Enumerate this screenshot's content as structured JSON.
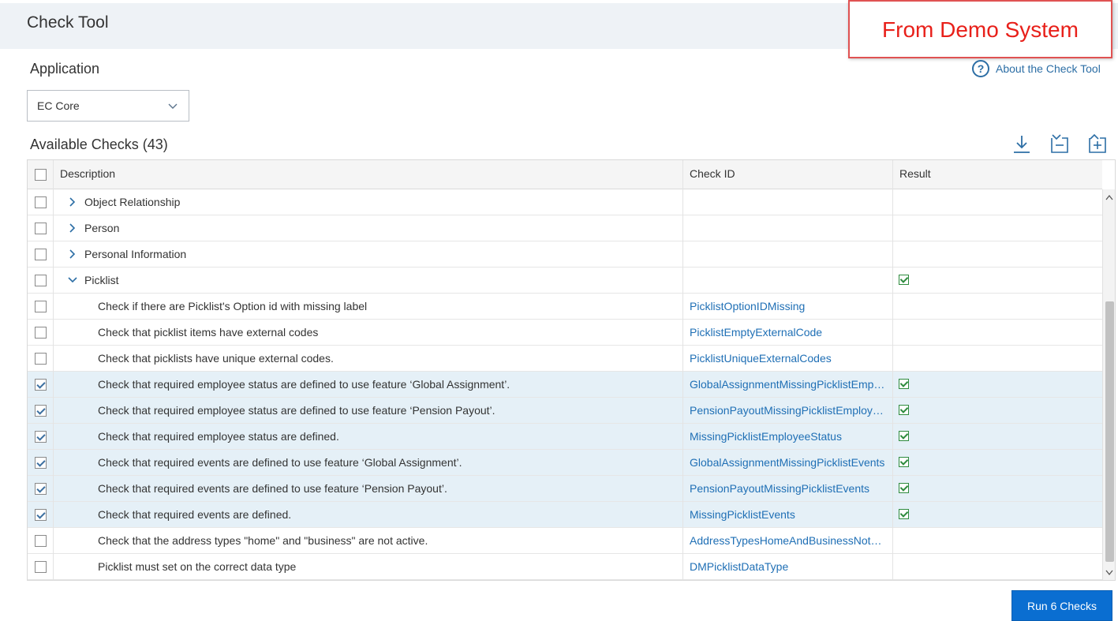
{
  "header": {
    "title": "Check Tool"
  },
  "annotation": {
    "text": "From Demo System"
  },
  "application": {
    "label": "Application",
    "selected": "EC Core",
    "about_icon": "?",
    "about_link": "About the Check Tool"
  },
  "checks": {
    "heading": "Available Checks (43)",
    "toolbar_icons": [
      "download-icon",
      "collapse-all-icon",
      "expand-all-icon"
    ],
    "columns": {
      "description": "Description",
      "check_id": "Check ID",
      "result": "Result"
    },
    "rows": [
      {
        "description": "Object Relationship",
        "check_id": "",
        "level": 0,
        "expander": "collapsed",
        "checked": false,
        "result": false
      },
      {
        "description": "Person",
        "check_id": "",
        "level": 0,
        "expander": "collapsed",
        "checked": false,
        "result": false
      },
      {
        "description": "Personal Information",
        "check_id": "",
        "level": 0,
        "expander": "collapsed",
        "checked": false,
        "result": false
      },
      {
        "description": "Picklist",
        "check_id": "",
        "level": 0,
        "expander": "expanded",
        "checked": false,
        "result": true
      },
      {
        "description": "Check if there are Picklist's Option id with missing label",
        "check_id": "PicklistOptionIDMissing",
        "level": 1,
        "expander": "none",
        "checked": false,
        "result": false
      },
      {
        "description": "Check that picklist items have external codes",
        "check_id": "PicklistEmptyExternalCode",
        "level": 1,
        "expander": "none",
        "checked": false,
        "result": false
      },
      {
        "description": "Check that picklists have unique external codes.",
        "check_id": "PicklistUniqueExternalCodes",
        "level": 1,
        "expander": "none",
        "checked": false,
        "result": false
      },
      {
        "description": "Check that required employee status are defined to use feature ‘Global Assignment’.",
        "check_id": "GlobalAssignmentMissingPicklistEmp…",
        "level": 1,
        "expander": "none",
        "checked": true,
        "result": true
      },
      {
        "description": "Check that required employee status are defined to use feature ‘Pension Payout’.",
        "check_id": "PensionPayoutMissingPicklistEmploy…",
        "level": 1,
        "expander": "none",
        "checked": true,
        "result": true
      },
      {
        "description": "Check that required employee status are defined.",
        "check_id": "MissingPicklistEmployeeStatus",
        "level": 1,
        "expander": "none",
        "checked": true,
        "result": true
      },
      {
        "description": "Check that required events are defined to use feature ‘Global Assignment’.",
        "check_id": "GlobalAssignmentMissingPicklistEvents",
        "level": 1,
        "expander": "none",
        "checked": true,
        "result": true
      },
      {
        "description": "Check that required events are defined to use feature ‘Pension Payout’.",
        "check_id": "PensionPayoutMissingPicklistEvents",
        "level": 1,
        "expander": "none",
        "checked": true,
        "result": true
      },
      {
        "description": "Check that required events are defined.",
        "check_id": "MissingPicklistEvents",
        "level": 1,
        "expander": "none",
        "checked": true,
        "result": true
      },
      {
        "description": "Check that the address types \"home\" and \"business\" are not active.",
        "check_id": "AddressTypesHomeAndBusinessNot…",
        "level": 1,
        "expander": "none",
        "checked": false,
        "result": false
      },
      {
        "description": "Picklist must set on the correct data type",
        "check_id": "DMPicklistDataType",
        "level": 1,
        "expander": "none",
        "checked": false,
        "result": false
      }
    ]
  },
  "footer": {
    "run_button": "Run 6 Checks"
  },
  "colors": {
    "accent": "#0a6ed1",
    "link": "#1f6fb5",
    "selected_row": "#e5f0f7",
    "annotation": "#e8201a",
    "result_ok": "#2e8b3e"
  }
}
